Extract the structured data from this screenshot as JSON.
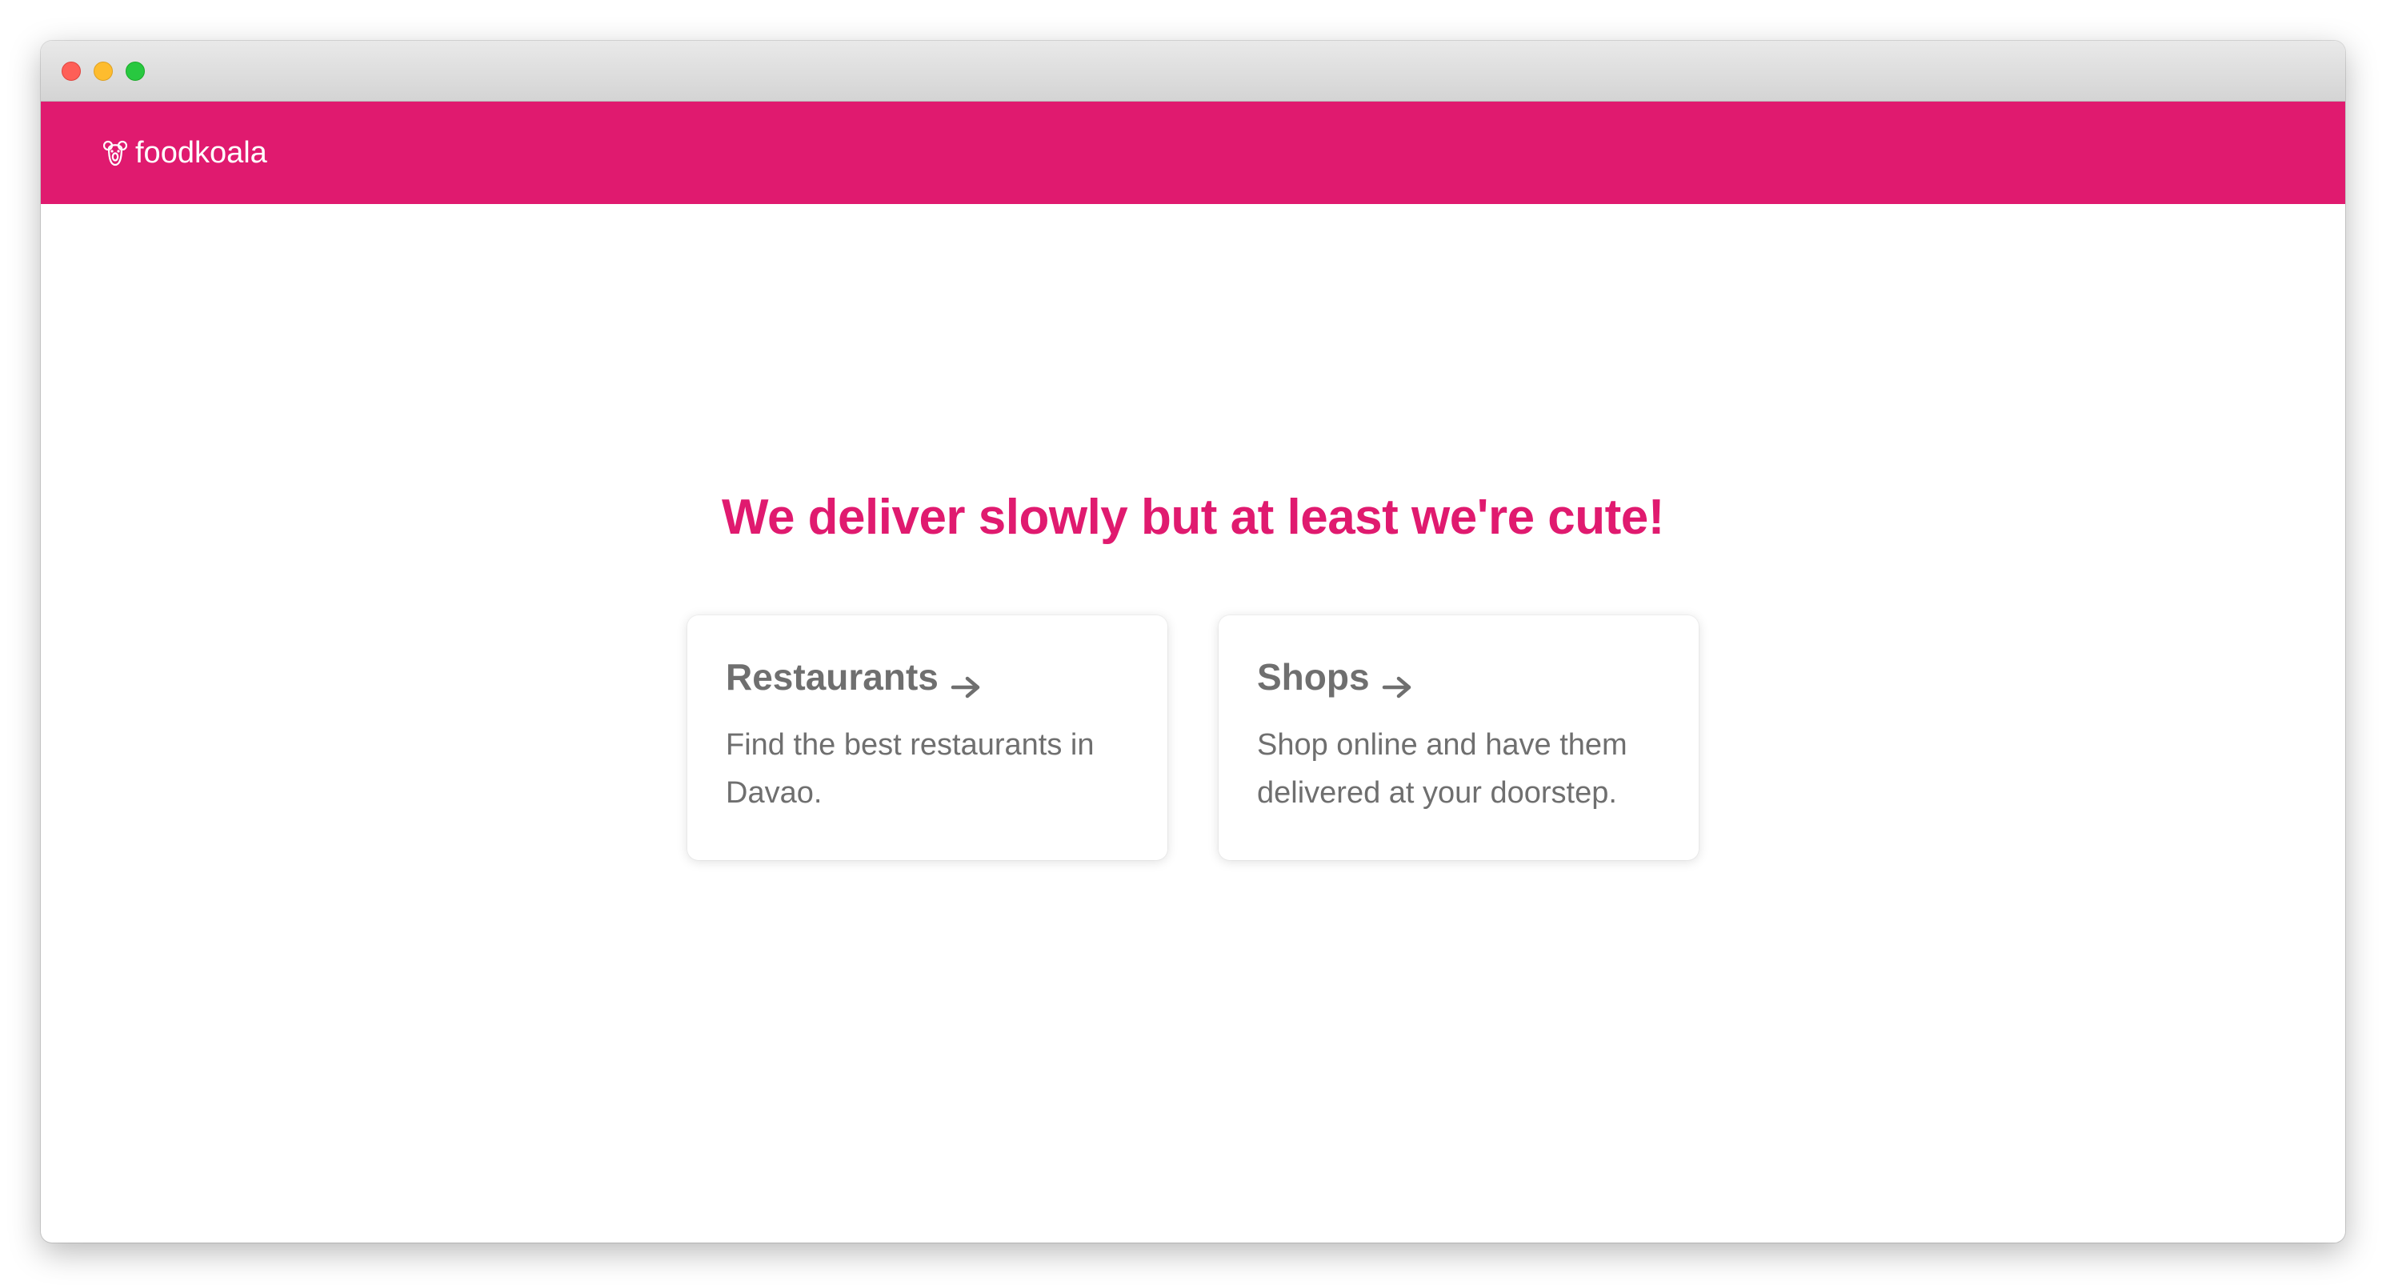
{
  "browser": {
    "window_controls": [
      "close",
      "minimize",
      "maximize"
    ]
  },
  "navbar": {
    "brand_icon": "koala-icon",
    "brand": "foodkoala",
    "color": "#e01a6f"
  },
  "hero": {
    "headline": "We deliver slowly but at least we're cute!"
  },
  "cards": [
    {
      "title": "Restaurants",
      "icon": "arrow-right-icon",
      "description": "Find the best restaurants in Davao."
    },
    {
      "title": "Shops",
      "icon": "arrow-right-icon",
      "description": "Shop online and have them delivered at your doorstep."
    }
  ],
  "colors": {
    "accent": "#e01a6f",
    "card_text": "#6f6f6f"
  }
}
